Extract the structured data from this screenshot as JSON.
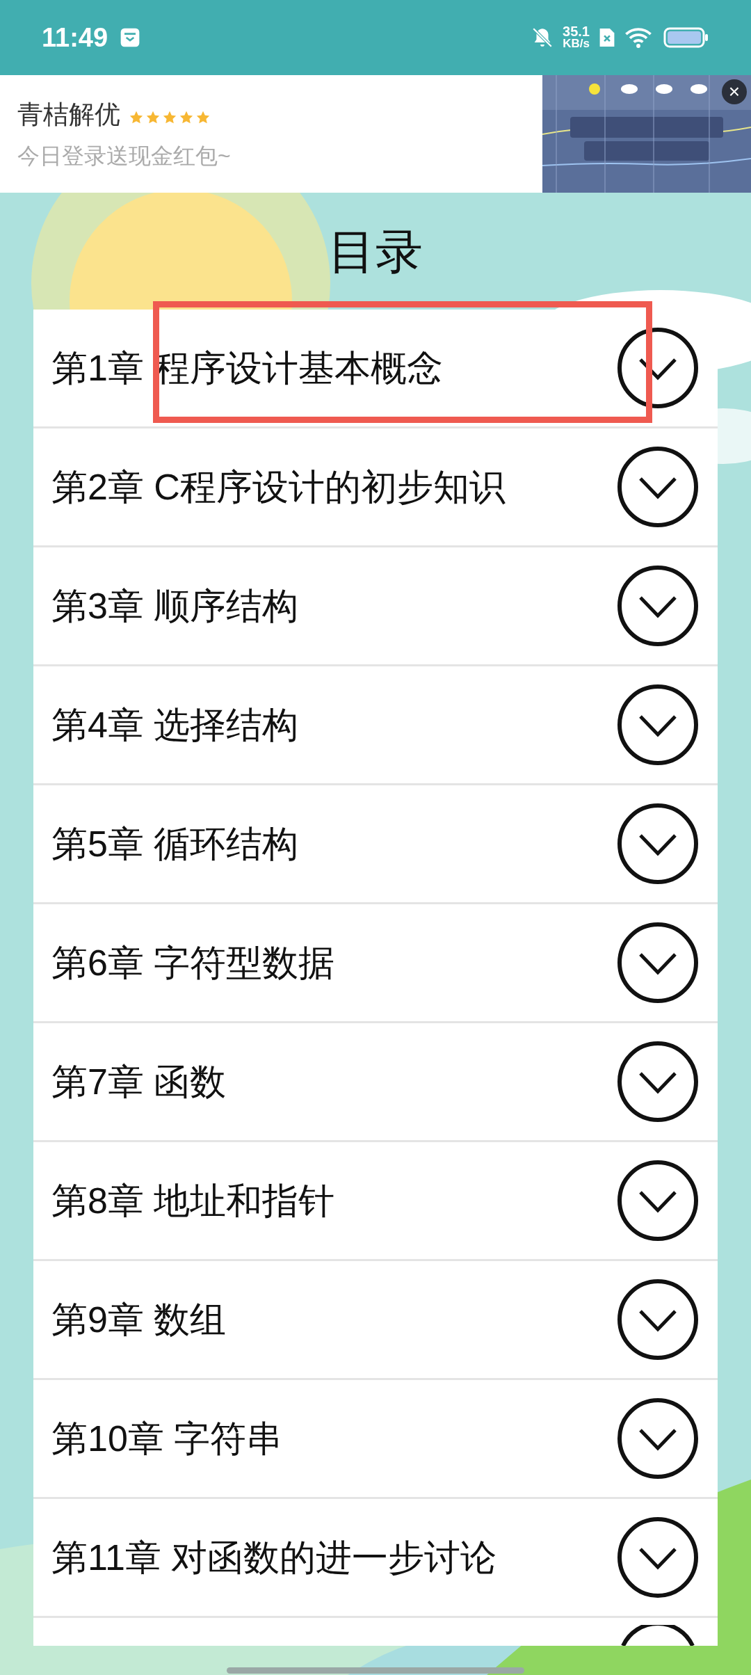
{
  "status_bar": {
    "time": "11:49",
    "speed_value": "35.1",
    "speed_unit": "KB/s"
  },
  "ad": {
    "title": "青桔解优",
    "stars": 5,
    "subtitle": "今日登录送现金红包~",
    "close": "×"
  },
  "title": "目录",
  "chapters": [
    {
      "label": "第1章 程序设计基本概念",
      "highlighted": true
    },
    {
      "label": "第2章 C程序设计的初步知识",
      "highlighted": false
    },
    {
      "label": "第3章 顺序结构",
      "highlighted": false
    },
    {
      "label": "第4章 选择结构",
      "highlighted": false
    },
    {
      "label": "第5章 循环结构",
      "highlighted": false
    },
    {
      "label": "第6章 字符型数据",
      "highlighted": false
    },
    {
      "label": "第7章 函数",
      "highlighted": false
    },
    {
      "label": "第8章 地址和指针",
      "highlighted": false
    },
    {
      "label": "第9章 数组",
      "highlighted": false
    },
    {
      "label": "第10章 字符串",
      "highlighted": false
    },
    {
      "label": "第11章 对函数的进一步讨论",
      "highlighted": false
    }
  ]
}
